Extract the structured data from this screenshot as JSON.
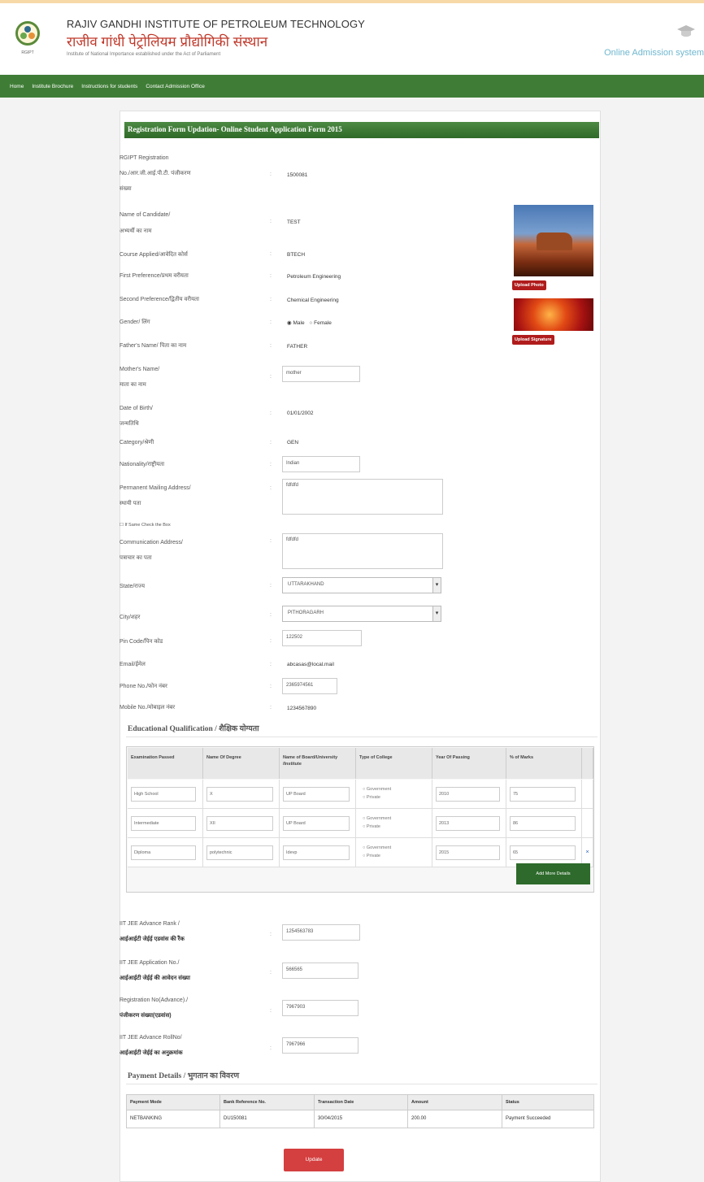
{
  "header": {
    "title_en": "RAJIV GANDHI INSTITUTE OF PETROLEUM TECHNOLOGY",
    "title_hi": "राजीव गांधी पेट्रोलियम प्रौद्योगिकी संस्थान",
    "subtitle": "Institute of National Importance established under the Act of Parliament",
    "right_label": "Online Admission system",
    "logo_icon": "institute-logo",
    "cap_icon": "graduation-cap-icon"
  },
  "nav": {
    "items": [
      "Home",
      "Institute Brochure",
      "Instructions for students",
      "Contact Admission Office"
    ]
  },
  "form": {
    "title": "Registration Form Updation- Online Student Application Form 2015",
    "labels": {
      "regno_1": "RGIPT Registration",
      "regno_2": "No./आर.जी.आई.पी.टी. पंजीकरण",
      "regno_3": "संख्या",
      "name_1": "Name of Candidate/",
      "name_2": "अभ्यर्थी का नाम",
      "course": "Course Applied/आवेदित कोर्स",
      "pref1": "First Preference/प्रथम वरीयता",
      "pref2": "Second Preference/द्वितीय वरीयता",
      "gender": "Gender/ लिंग",
      "father": "Father's Name/ पिता का नाम",
      "mother_1": "Mother's Name/",
      "mother_2": "माता का नाम",
      "dob_1": "Date of Birth/",
      "dob_2": "जन्मतिथि",
      "category": "Category/श्रेणी",
      "nationality": "Nationality/राष्ट्रीयता",
      "perm_1": "Permanent Mailing Address/",
      "perm_2": "स्थायी पता",
      "same_check": "If Same Check the Box",
      "comm_1": "Communication Address/",
      "comm_2": "पत्राचार का पता",
      "state": "State/राज्य",
      "city": "City/शहर",
      "pin": "Pin Code/पिन कोड",
      "email": "Email/ईमेल",
      "phone": "Phone No./फोन नंबर",
      "mobile": "Mobile No./मोबाइल नंबर"
    },
    "colon": ":",
    "values": {
      "regno": "1500081",
      "name": "TEST",
      "course": "BTECH",
      "pref1": "Petroleum Engineering",
      "pref2": "Chemical Engineering",
      "gender_male": "Male",
      "gender_female": "Female",
      "father": "FATHER",
      "mother": "mother",
      "dob": "01/01/2002",
      "category": "GEN",
      "nationality": "Indian",
      "perm_address": "fdfdfd",
      "comm_address": "fdfdfd",
      "state": "UTTARAKHAND",
      "city": "PITHORAGARH",
      "pin": "122502",
      "email": "abcasas@local.mail",
      "phone": "2365974561",
      "mobile": "1234567890"
    },
    "upload_photo": "Upload Photo",
    "upload_signature": "Upload Signature"
  },
  "education": {
    "heading": "Educational Qualification / शैक्षिक योग्यता",
    "headers": [
      "Examination Passed",
      "Name Of Degree",
      "Name of Board/University /Institute",
      "Type of College",
      "Year Of Passing",
      "% of Marks"
    ],
    "rows": [
      {
        "exam": "High School",
        "degree": "X",
        "board": "UP Board",
        "year": "2010",
        "marks": "75"
      },
      {
        "exam": "Intermediate",
        "degree": "XII",
        "board": "UP Board",
        "year": "2013",
        "marks": "86"
      },
      {
        "exam": "Diploma",
        "degree": "polytechnic",
        "board": "Idevp",
        "year": "2015",
        "marks": "65"
      }
    ],
    "radio_gov": "Government",
    "radio_pvt": "Private",
    "add_more": "Add More Details",
    "remove_icon": "remove-icon"
  },
  "jee": {
    "rank_1": "IIT JEE Advance Rank /",
    "rank_2": "आईआईटी जेईई एडवांस की रैंक",
    "rank_val": "1254563783",
    "app_1": "IIT JEE Application No./",
    "app_2": "आईआईटी जेईई की आवेदन संख्या",
    "app_val": "566565",
    "reg_1": "Registration No(Advance)./",
    "reg_2": "पंजीकरण संख्या(एडवांस)",
    "reg_val": "7967903",
    "roll_1": "IIT JEE Advance RollNo/",
    "roll_2": "आईआईटी जेईई का अनुक्रमांक",
    "roll_val": "7967966"
  },
  "payment": {
    "heading": "Payment Details / भुगतान का विवरण",
    "headers": [
      "Payment Mode",
      "Bank Reference No.",
      "Transaction Date",
      "Amount",
      "Status"
    ],
    "row": [
      "NETBANKING",
      "DU150081",
      "30/04/2015",
      "200.00",
      "Payment Succeeded"
    ]
  },
  "update_button": "Update"
}
